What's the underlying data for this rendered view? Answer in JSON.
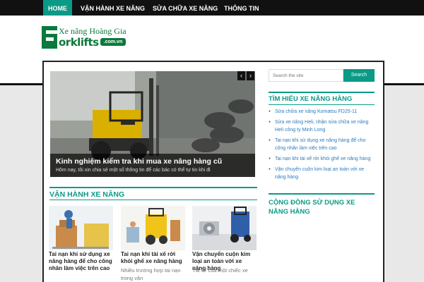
{
  "nav": {
    "items": [
      {
        "label": "HOME",
        "active": true
      },
      {
        "label": "VẬN HÀNH XE NÂNG",
        "active": false
      },
      {
        "label": "SỬA CHỮA XE NÂNG",
        "active": false
      },
      {
        "label": "THÔNG TIN",
        "active": false
      }
    ]
  },
  "logo": {
    "tagline": "Xe nâng Hoàng Gia",
    "wordmark": "orklifts",
    "domain": ".com.vn",
    "brand_color": "#0a7a3c"
  },
  "slider": {
    "title": "Kinh nghiệm kiểm tra khi mua xe nâng hàng cũ",
    "excerpt": "Hôm nay, tôi xin chia sẻ một số thông tin để các bác có thể tự tin khi đi",
    "prev_icon": "‹",
    "next_icon": "›"
  },
  "section": {
    "title": "VẬN HÀNH XE NÂNG",
    "accent": "#0b9a86"
  },
  "articles": [
    {
      "title": "Tai nạn khi sử dụng xe nâng hàng để cho công nhân làm việc trên cao",
      "excerpt": ""
    },
    {
      "title": "Tai nạn khi tài xế rời khỏi ghế xe nâng hàng",
      "excerpt": "Nhiều trường hợp tai nạn trong vận"
    },
    {
      "title": "Vận chuyển cuộn kim loại an toàn với xe nâng hàng",
      "excerpt": "Tài xế của một chiếc xe"
    }
  ],
  "sidebar": {
    "search_placeholder": "Search the site",
    "search_button": "Search",
    "widget_title": "TÌM HIỂU XE NÂNG HÀNG",
    "links": [
      "Sửa chữa xe nâng Komatsu FD25-11",
      "Sửa xe nâng Heli, nhận sửa chữa xe nâng Heli công ty Minh Long",
      "Tai nạn khi sử dụng xe nâng hàng để cho công nhân làm việc trên cao",
      "Tai nạn khi tài xế rời khỏi ghế xe nâng hàng",
      "Vận chuyển cuộn kim loại an toàn với xe nâng hàng"
    ],
    "widget2_title": "CỘNG ĐỒNG SỬ DỤNG XE NÂNG HÀNG"
  }
}
